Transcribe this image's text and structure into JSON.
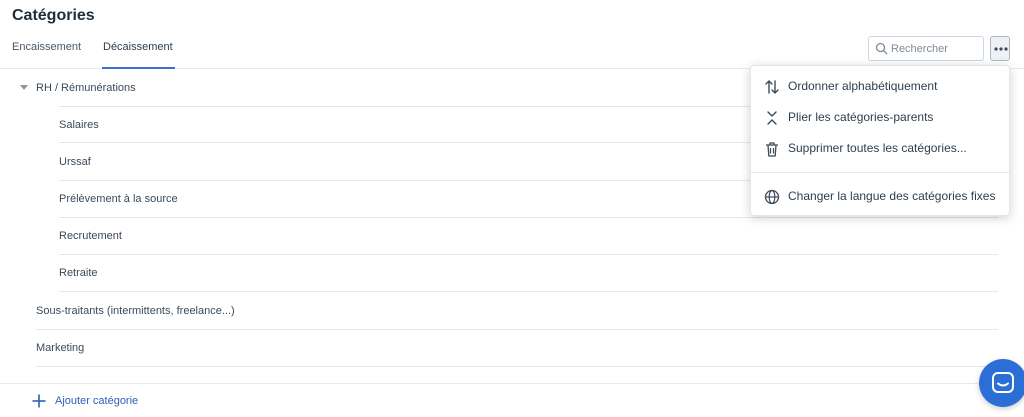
{
  "header": {
    "title": "Catégories"
  },
  "tabs": [
    {
      "label": "Encaissement",
      "active": false
    },
    {
      "label": "Décaissement",
      "active": true
    }
  ],
  "search": {
    "placeholder": "Rechercher",
    "value": ""
  },
  "categories": {
    "group": "RH / Rémunérations",
    "children": [
      "Salaires",
      "Urssaf",
      "Prélèvement à la source",
      "Recrutement",
      "Retraite"
    ],
    "others": [
      "Sous-traitants (intermittents, freelance...)",
      "Marketing"
    ]
  },
  "menu": {
    "items": [
      {
        "label": "Ordonner alphabétiquement",
        "icon": "sort-arrows-icon"
      },
      {
        "label": "Plier les catégories-parents",
        "icon": "collapse-icon"
      },
      {
        "label": "Supprimer toutes les catégories...",
        "icon": "trash-icon"
      },
      {
        "label": "Changer la langue des catégories fixes",
        "icon": "globe-icon"
      }
    ]
  },
  "footer": {
    "add_label": "Ajouter catégorie"
  },
  "colors": {
    "accent": "#3b6fd6",
    "chat": "#2b6fd6",
    "link": "#2e5fb8"
  }
}
